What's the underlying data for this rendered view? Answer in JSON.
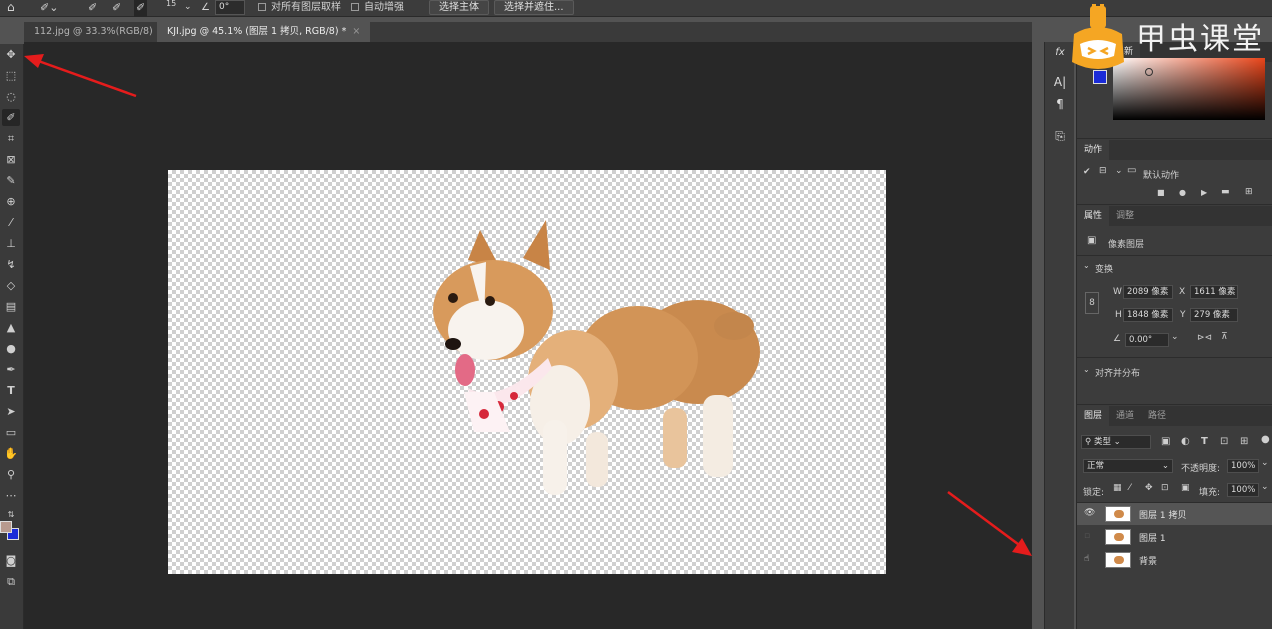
{
  "options_bar": {
    "brush_size": "15",
    "angle": "0°",
    "sample_all_layers": "对所有图层取样",
    "auto_enhance": "自动增强",
    "select_subject": "选择主体",
    "select_and_mask": "选择并遮住..."
  },
  "tabs": [
    {
      "label": "112.jpg @ 33.3%(RGB/8)",
      "close": "×"
    },
    {
      "label": "KJI.jpg @ 45.1% (图层 1 拷贝, RGB/8) *",
      "close": "×"
    }
  ],
  "color_panel": {
    "title_fragment": "新",
    "accent": "#e8451a"
  },
  "actions_panel": {
    "title": "动作",
    "default_set": "默认动作"
  },
  "properties_panel": {
    "tabs": [
      "属性",
      "调整"
    ],
    "layer_type": "像素图层",
    "transform_title": "变换",
    "w_label": "W",
    "w_value": "2089 像素",
    "x_label": "X",
    "x_value": "1611 像素",
    "h_label": "H",
    "h_value": "1848 像素",
    "y_label": "Y",
    "y_value": "279 像素",
    "angle_value": "0.00°",
    "align_title": "对齐并分布"
  },
  "layers_panel": {
    "tabs": [
      "图层",
      "通道",
      "路径"
    ],
    "filter_kind": "类型",
    "blend_mode": "正常",
    "opacity_label": "不透明度:",
    "opacity_value": "100%",
    "lock_label": "锁定:",
    "fill_label": "填充:",
    "fill_value": "100%",
    "layers": [
      {
        "name": "图层 1 拷贝",
        "visible": true,
        "selected": true
      },
      {
        "name": "图层 1",
        "visible": false,
        "selected": false
      },
      {
        "name": "背景",
        "visible": false,
        "selected": false
      }
    ]
  },
  "watermark": {
    "text": "甲虫课堂",
    "logo_color": "#f5a623"
  },
  "colors": {
    "foreground": "#b89a8e",
    "background": "#1a2bd8"
  }
}
